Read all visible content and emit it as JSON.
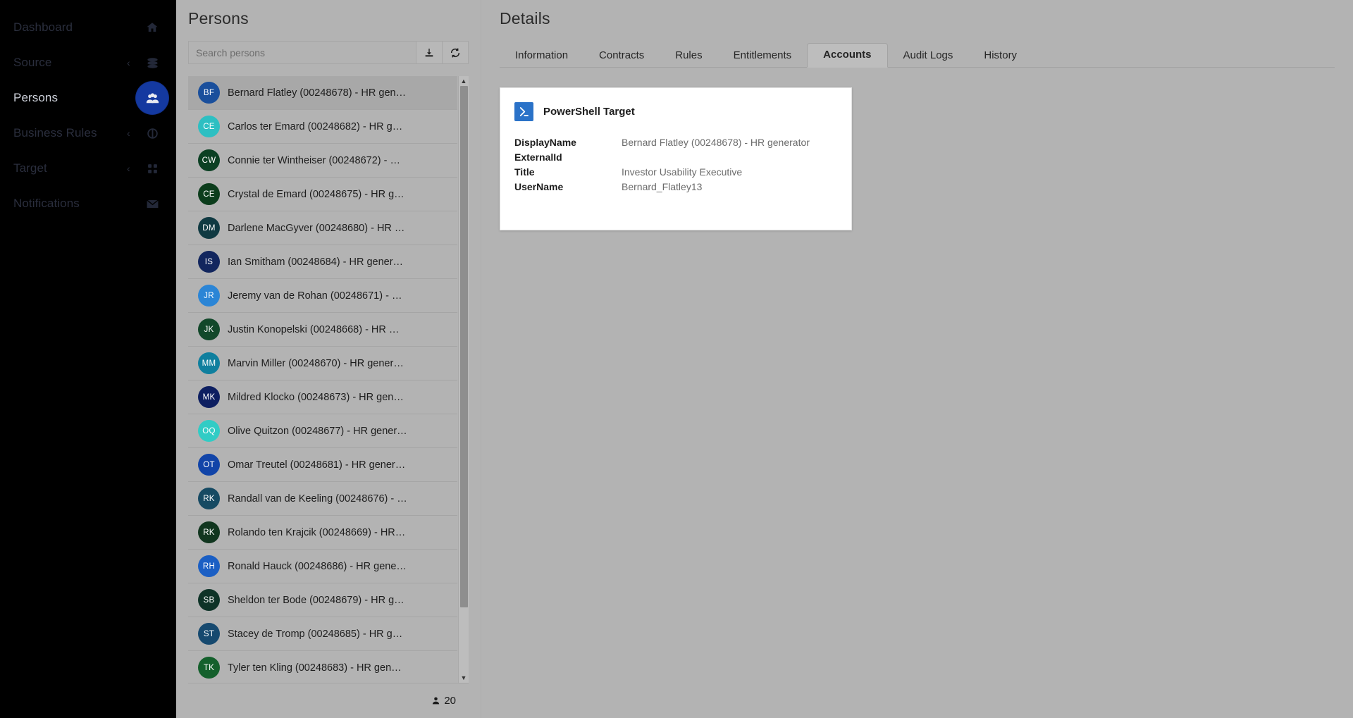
{
  "sidebar": {
    "items": [
      {
        "label": "Dashboard",
        "icon": "home-icon",
        "chevron": false,
        "active": false
      },
      {
        "label": "Source",
        "icon": "database-icon",
        "chevron": true,
        "active": false
      },
      {
        "label": "Persons",
        "icon": "people-icon",
        "chevron": false,
        "active": true
      },
      {
        "label": "Business Rules",
        "icon": "rules-icon",
        "chevron": true,
        "active": false
      },
      {
        "label": "Target",
        "icon": "grid-icon",
        "chevron": true,
        "active": false
      },
      {
        "label": "Notifications",
        "icon": "envelope-icon",
        "chevron": false,
        "active": false
      }
    ],
    "accent_color": "#1439a0",
    "chevron_glyph": "‹"
  },
  "list_panel": {
    "title": "Persons",
    "search": {
      "value": "",
      "placeholder": "Search persons"
    },
    "export_button": {
      "name": "download-icon",
      "title": "Export"
    },
    "refresh_button": {
      "name": "refresh-icon",
      "title": "Refresh"
    },
    "footer": {
      "icon": "person-icon",
      "count": "20"
    },
    "scrollbar": {
      "up": "▲",
      "down": "▼"
    },
    "persons": [
      {
        "initials": "BF",
        "color": "#1a4f9c",
        "name": "Bernard Flatley (00248678) - HR gen…",
        "selected": true
      },
      {
        "initials": "CE",
        "color": "#2dbfc2",
        "name": "Carlos ter Emard (00248682) - HR g…",
        "selected": false
      },
      {
        "initials": "CW",
        "color": "#0b4023",
        "name": "Connie ter Wintheiser (00248672) - …",
        "selected": false
      },
      {
        "initials": "CE",
        "color": "#0c3d1c",
        "name": "Crystal de Emard (00248675) - HR g…",
        "selected": false
      },
      {
        "initials": "DM",
        "color": "#103a42",
        "name": "Darlene MacGyver (00248680) - HR …",
        "selected": false
      },
      {
        "initials": "IS",
        "color": "#12265e",
        "name": "Ian Smitham (00248684) - HR gener…",
        "selected": false
      },
      {
        "initials": "JR",
        "color": "#2b85d6",
        "name": "Jeremy van de Rohan (00248671) - …",
        "selected": false
      },
      {
        "initials": "JK",
        "color": "#12482a",
        "name": "Justin Konopelski (00248668) - HR …",
        "selected": false
      },
      {
        "initials": "MM",
        "color": "#0f7f9e",
        "name": "Marvin Miller (00248670) - HR gener…",
        "selected": false
      },
      {
        "initials": "MK",
        "color": "#0d1f61",
        "name": "Mildred Klocko (00248673) - HR gen…",
        "selected": false
      },
      {
        "initials": "OQ",
        "color": "#31ccc5",
        "name": "Olive Quitzon (00248677) - HR gener…",
        "selected": false
      },
      {
        "initials": "OT",
        "color": "#1144a8",
        "name": "Omar Treutel (00248681) - HR gener…",
        "selected": false
      },
      {
        "initials": "RK",
        "color": "#164a63",
        "name": "Randall van de Keeling (00248676) - …",
        "selected": false
      },
      {
        "initials": "RK",
        "color": "#11361f",
        "name": "Rolando ten Krajcik (00248669) - HR…",
        "selected": false
      },
      {
        "initials": "RH",
        "color": "#1b5fc4",
        "name": "Ronald Hauck (00248686) - HR gene…",
        "selected": false
      },
      {
        "initials": "SB",
        "color": "#0e3327",
        "name": "Sheldon ter Bode (00248679) - HR g…",
        "selected": false
      },
      {
        "initials": "ST",
        "color": "#16496f",
        "name": "Stacey de Tromp (00248685) - HR g…",
        "selected": false
      },
      {
        "initials": "TK",
        "color": "#14602c",
        "name": "Tyler ten Kling (00248683) - HR gen…",
        "selected": false
      }
    ]
  },
  "details_panel": {
    "title": "Details",
    "tabs": [
      {
        "label": "Information",
        "active": false
      },
      {
        "label": "Contracts",
        "active": false
      },
      {
        "label": "Rules",
        "active": false
      },
      {
        "label": "Entitlements",
        "active": false
      },
      {
        "label": "Accounts",
        "active": true
      },
      {
        "label": "Audit Logs",
        "active": false
      },
      {
        "label": "History",
        "active": false
      }
    ],
    "account_card": {
      "icon": "powershell-icon",
      "icon_color": "#2a72c8",
      "title": "PowerShell Target",
      "fields": [
        {
          "key": "DisplayName",
          "value": "Bernard Flatley (00248678) - HR generator"
        },
        {
          "key": "ExternalId",
          "value": ""
        },
        {
          "key": "Title",
          "value": "Investor Usability Executive"
        },
        {
          "key": "UserName",
          "value": "Bernard_Flatley13"
        }
      ]
    }
  }
}
